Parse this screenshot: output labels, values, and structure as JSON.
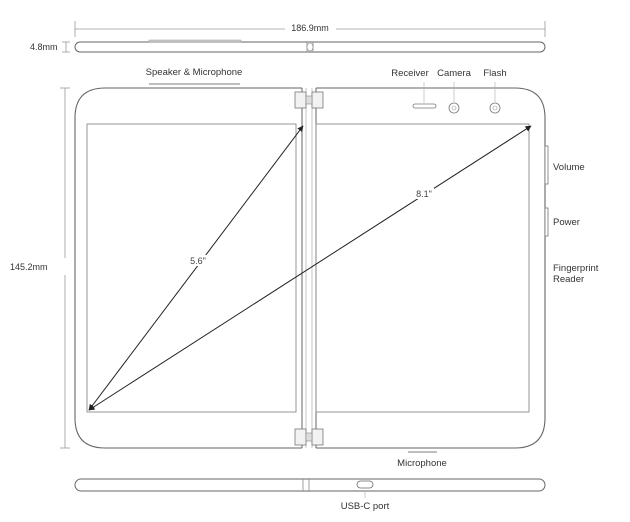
{
  "dimensions": {
    "width": "186.9mm",
    "height": "145.2mm",
    "thickness": "4.8mm"
  },
  "labels": {
    "speaker_microphone": "Speaker & Microphone",
    "receiver": "Receiver",
    "camera": "Camera",
    "flash": "Flash",
    "volume": "Volume",
    "power": "Power",
    "fingerprint_line1": "Fingerprint",
    "fingerprint_line2": "Reader",
    "microphone": "Microphone",
    "usbc": "USB-C port"
  },
  "diagonals": {
    "single_screen": "5.6\"",
    "dual_screen": "8.1\""
  },
  "colors": {
    "outline": "#666666",
    "dimension_line": "#9a9a9a",
    "label_text": "#333333"
  }
}
